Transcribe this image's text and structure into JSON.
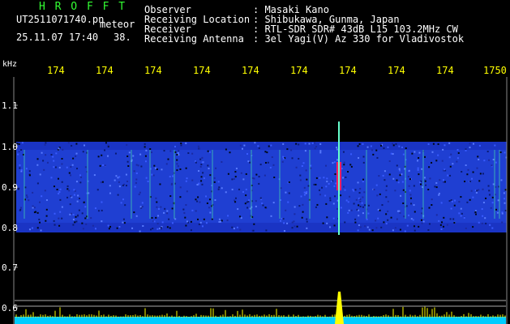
{
  "header": {
    "app_name": "HROFFT",
    "file_name": "UT2511071740.pn",
    "file_type": "meteor",
    "timestamp": "25.11.07 17:40",
    "count": "38."
  },
  "info": {
    "observer": {
      "label": "Observer",
      "value": ": Masaki Kano"
    },
    "location": {
      "label": "Receiving Location",
      "value": ": Shibukawa, Gunma, Japan"
    },
    "receiver": {
      "label": "Receiver",
      "value": ": RTL-SDR SDR# 43dB L15 103.2MHz CW"
    },
    "antenna": {
      "label": "Receiving Antenna",
      "value": ": 3el Yagi(V) Az 330 for Vladivostok"
    }
  },
  "axes": {
    "y_unit": "kHz",
    "x_ticks": [
      "174",
      "174",
      "174",
      "174",
      "174",
      "174",
      "174",
      "174",
      "174",
      "1750"
    ],
    "y_ticks": [
      "1.1",
      "1.0",
      "0.9",
      "0.8",
      "0.7",
      "0.6"
    ]
  },
  "colors": {
    "noise": "#2244d8",
    "header_text": "#ffffff",
    "brand": "#33ff33",
    "x_labels": "#ffff00",
    "baseline": "#00ccff",
    "spike": "#ffff00",
    "meteor_hot": "#ff2060"
  }
}
